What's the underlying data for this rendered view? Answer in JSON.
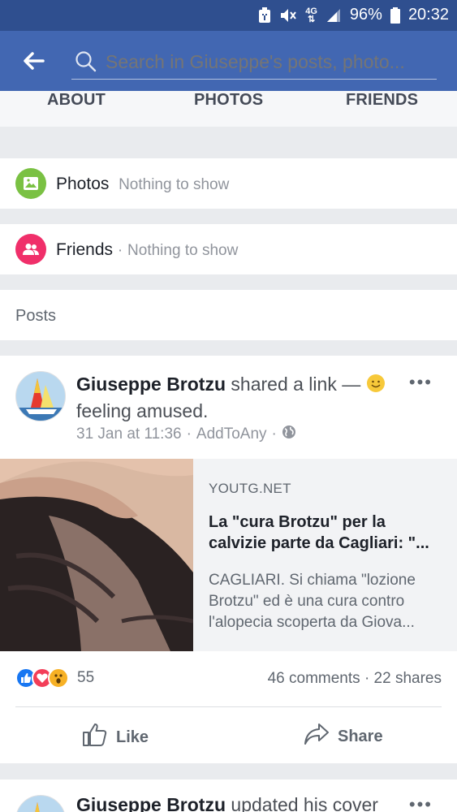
{
  "status_bar": {
    "battery": "96%",
    "time": "20:32",
    "network": "4G"
  },
  "search": {
    "placeholder": "Search in Giuseppe's posts, photo..."
  },
  "tabs": [
    {
      "label": "ABOUT"
    },
    {
      "label": "PHOTOS"
    },
    {
      "label": "FRIENDS"
    }
  ],
  "sections": {
    "photos": {
      "title": "Photos",
      "status": "Nothing to show",
      "icon": "photo-icon",
      "color": "#7ac143"
    },
    "friends": {
      "title": "Friends",
      "separator": "·",
      "status": "Nothing to show",
      "icon": "friends-icon",
      "color": "#f02f6a"
    },
    "posts": {
      "title": "Posts"
    }
  },
  "post": {
    "author": "Giuseppe Brotzu",
    "action": "shared a link —",
    "feeling": "feeling amused.",
    "date": "31 Jan at 11:36",
    "source": "AddToAny",
    "sep": "·",
    "privacy_icon": "globe-icon",
    "link": {
      "domain": "YOUTG.NET",
      "title": "La \"cura Brotzu\" per la calvizie parte da Cagliari: \"...",
      "description": "CAGLIARI. Si chiama \"lozione Brotzu\" ed è una cura contro l'alopecia scoperta da Giova..."
    },
    "reactions_count": "55",
    "comments": "46 comments",
    "shares": "22 shares",
    "counts_sep": "·",
    "like_label": "Like",
    "share_label": "Share"
  },
  "post2": {
    "author": "Giuseppe Brotzu",
    "action": "updated his cover"
  },
  "colors": {
    "header": "#4267b2",
    "status_bar": "#2f4f8f",
    "like": "#1877f2",
    "love": "#f33e58",
    "wow": "#f7b125"
  }
}
